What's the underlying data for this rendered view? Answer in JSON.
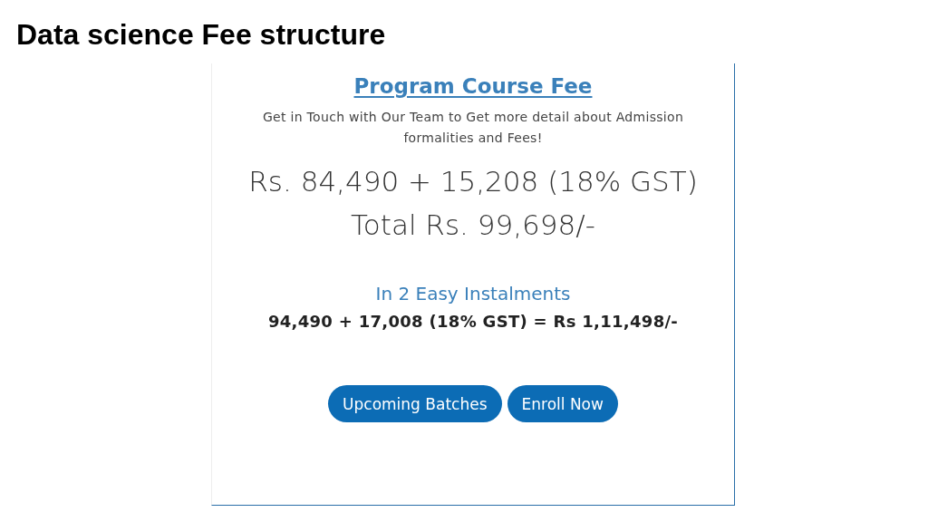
{
  "slide_title": "Data science Fee structure",
  "card": {
    "heading": "Program Course Fee",
    "description": "Get in Touch with Our Team to Get more detail about Admission formalities and Fees!",
    "price_lines": [
      "Rs. 84,490 + 15,208 (18% GST)",
      "Total Rs. 99,698/-"
    ],
    "instalment_heading": "In 2 Easy Instalments",
    "instalment_detail": "94,490 + 17,008 (18% GST) = Rs 1,11,498/-",
    "buttons": [
      "Upcoming Batches",
      "Enroll Now"
    ]
  }
}
